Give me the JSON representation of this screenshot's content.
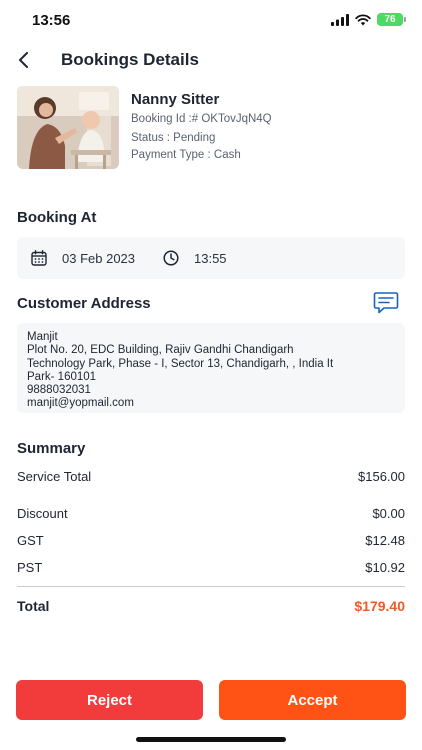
{
  "status_bar": {
    "time": "13:56",
    "battery": "76"
  },
  "header": {
    "title": "Bookings Details"
  },
  "service": {
    "name": "Nanny Sitter",
    "booking_id": "Booking Id :# OKTovJqN4Q",
    "status": "Status : Pending",
    "payment_type": "Payment Type : Cash"
  },
  "booking_at": {
    "title": "Booking At",
    "date": "03 Feb 2023",
    "time": "13:55"
  },
  "customer_address": {
    "title": "Customer Address",
    "lines": [
      "Manjit",
      "Plot No. 20, EDC Building, Rajiv Gandhi Chandigarh",
      "Technology Park, Phase - I, Sector 13, Chandigarh, , India It",
      "Park- 160101",
      "9888032031",
      "manjit@yopmail.com"
    ]
  },
  "summary": {
    "title": "Summary",
    "rows": [
      {
        "label": "Service Total",
        "value": "$156.00"
      },
      {
        "label": "Discount",
        "value": "$0.00"
      },
      {
        "label": "GST",
        "value": "$12.48"
      },
      {
        "label": "PST",
        "value": "$10.92"
      }
    ],
    "total_label": "Total",
    "total_value": "$179.40"
  },
  "actions": {
    "reject_label": "Reject",
    "accept_label": "Accept"
  },
  "colors": {
    "accent": "#ff5214",
    "reject": "#f23b3b",
    "total": "#f15a24",
    "icon": "#1565c0"
  },
  "icons": [
    "back-arrow",
    "calendar",
    "clock",
    "chat-bubble",
    "signal",
    "wifi",
    "battery"
  ]
}
